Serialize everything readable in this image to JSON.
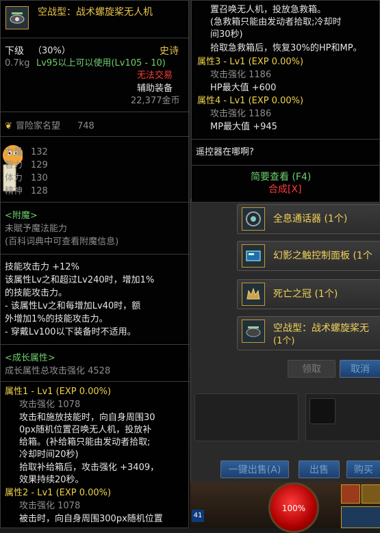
{
  "left_tooltip": {
    "item_name": "空战型：战术螺旋桨无人机",
    "grade": "下级",
    "grade_pct": "（30%）",
    "rarity": "史诗",
    "weight": "0.7kg",
    "level_req": "Lv95以上可以使用(Lv105 - 10)",
    "trade_status": "无法交易",
    "equip_type": "辅助装备",
    "price": "22,377金币",
    "fame_label": "冒险家名望",
    "fame_value": "748",
    "stats": [
      {
        "name": "力量",
        "value": "132"
      },
      {
        "name": "智力",
        "value": "129"
      },
      {
        "name": "体力",
        "value": "130"
      },
      {
        "name": "精神",
        "value": "128"
      }
    ],
    "enchant_title": "<附魔>",
    "enchant_lines": [
      "未賦予魔法能力",
      "(百科词典中可查看附魔信息)"
    ],
    "skill_lines": [
      "技能攻击力 +12%",
      "该属性Lv之和超过Lv240时，增加1%",
      "的技能攻击力。",
      "- 该属性Lv之和每增加Lv40时，额",
      "外增加1%的技能攻击力。",
      "- 穿戴Lv100以下装备时不适用。"
    ],
    "growth_title": "<成长属性>",
    "growth_total": "成长属性总攻击强化 4528",
    "attr1": {
      "title": "属性1 - Lv1 (EXP 0.00%)",
      "atk": "攻击强化 1078",
      "lines": [
        "攻击和施放技能时，向自身周围30",
        "0px随机位置召唤无人机，投放补",
        "给箱。(补给箱只能由发动者拾取;",
        "冷却时间20秒)",
        "拾取补给箱后，攻击强化 +3409，",
        "效果持续20秒。"
      ]
    },
    "attr2": {
      "title": "属性2 - Lv1 (EXP 0.00%)",
      "atk": "攻击强化 1078",
      "line": "被击时，向自身周围300px随机位置"
    }
  },
  "right_tooltip": {
    "lines_top": [
      "置召唤无人机，投放急救箱。",
      "(急救箱只能由发动者拾取;冷却时",
      "间30秒)",
      "拾取急救箱后，恢复30%的HP和MP。"
    ],
    "attr3": {
      "title": "属性3 - Lv1 (EXP 0.00%)",
      "atk": "攻击强化 1186",
      "bonus": "HP最大值 +600"
    },
    "attr4": {
      "title": "属性4 - Lv1 (EXP 0.00%)",
      "atk": "攻击强化 1186",
      "bonus": "MP最大值 +945"
    },
    "question": "遥控器在哪啊?",
    "brief_view": "简要查看 (F4)",
    "compose": "合成[X]"
  },
  "shop": {
    "items": [
      {
        "name": "全息通话器 (1个)"
      },
      {
        "name": "幻影之触控制面板 (1个"
      },
      {
        "name": "死亡之冠 (1个)"
      },
      {
        "name": "空战型：战术螺旋桨无",
        "sub": "(1个)"
      }
    ],
    "btn_claim": "领取",
    "btn_cancel": "取消",
    "btn_sell_all": "一键出售(A)",
    "btn_sell": "出售",
    "btn_buy": "购买"
  },
  "hud": {
    "hp_pct": "100%",
    "level_badge": "41"
  },
  "colors": {
    "gold": "#e8c34a",
    "green": "#6fcf6f",
    "red": "#ff3a3a",
    "grey": "#8e8e8e"
  }
}
